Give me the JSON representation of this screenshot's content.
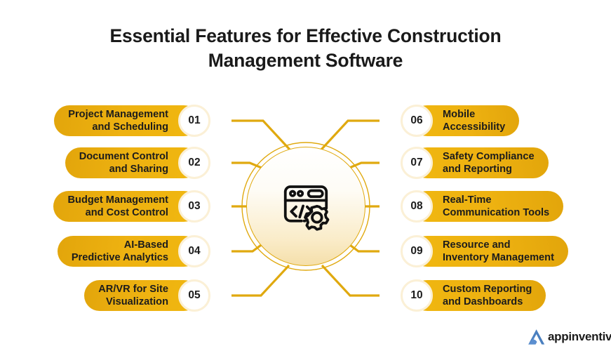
{
  "page": {
    "background": "#ffffff",
    "accent_gold": "#eeb211",
    "accent_gold_dark": "#e0a90f",
    "badge_ring": "#fbf0d6",
    "text_dark": "#1c1c1c",
    "logo_blue": "#4a7fbf"
  },
  "title": {
    "line1": "Essential Features for Effective Construction",
    "line2": "Management Software"
  },
  "center": {
    "icon_name": "code-window-gear-icon"
  },
  "items_left": [
    {
      "number": "01",
      "label": "Project Management\nand Scheduling"
    },
    {
      "number": "02",
      "label": "Document Control\nand Sharing"
    },
    {
      "number": "03",
      "label": "Budget Management\nand Cost Control"
    },
    {
      "number": "04",
      "label": "AI-Based\nPredictive Analytics"
    },
    {
      "number": "05",
      "label": "AR/VR for Site\nVisualization"
    }
  ],
  "items_right": [
    {
      "number": "06",
      "label": "Mobile\nAccessibility"
    },
    {
      "number": "07",
      "label": "Safety Compliance\nand Reporting"
    },
    {
      "number": "08",
      "label": "Real-Time\nCommunication Tools"
    },
    {
      "number": "09",
      "label": "Resource and\nInventory Management"
    },
    {
      "number": "10",
      "label": "Custom Reporting\nand Dashboards"
    }
  ],
  "logo": {
    "text": "appinventiv",
    "mark_name": "appinventiv-chevron-logo-icon"
  }
}
